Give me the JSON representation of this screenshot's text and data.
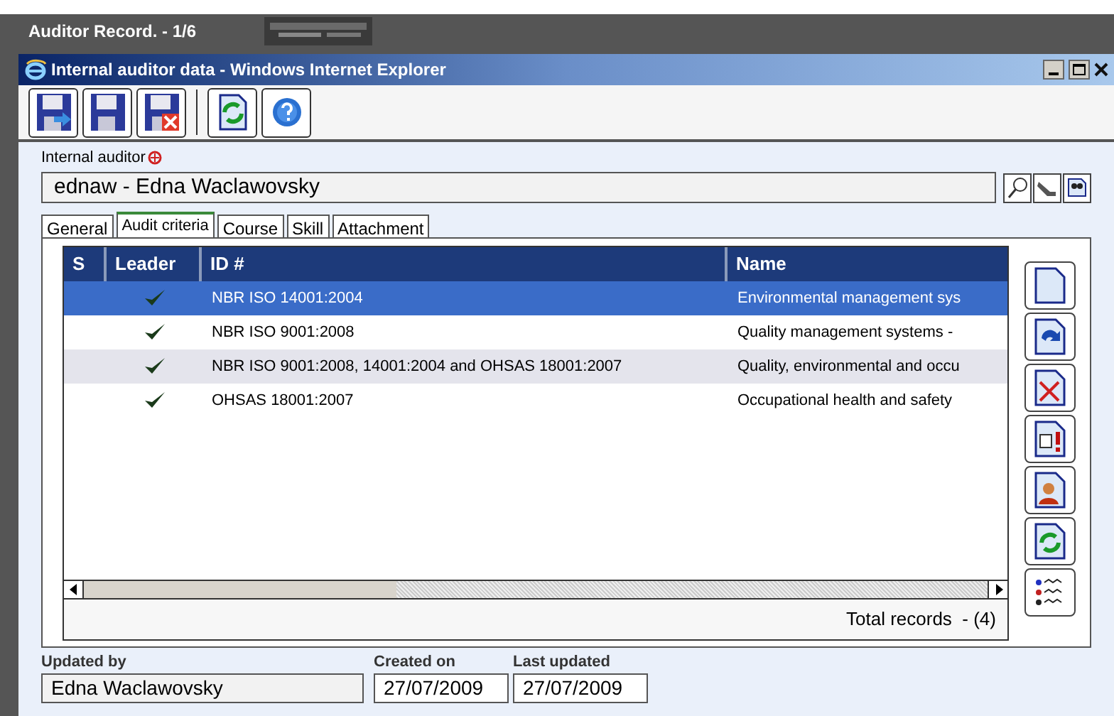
{
  "app_bar": {
    "title": "Auditor Record. - 1/6"
  },
  "window": {
    "title": "Internal auditor data - Windows Internet Explorer"
  },
  "auditor": {
    "label": "Internal auditor",
    "value": "ednaw - Edna Waclawovsky"
  },
  "tabs": [
    {
      "label": "General",
      "selected": false
    },
    {
      "label": "Audit criteria",
      "selected": true
    },
    {
      "label": "Course",
      "selected": false
    },
    {
      "label": "Skill",
      "selected": false
    },
    {
      "label": "Attachment",
      "selected": false
    }
  ],
  "table": {
    "columns": [
      "S",
      "Leader",
      "ID #",
      "Name"
    ],
    "rows": [
      {
        "id": "NBR ISO 14001:2004",
        "name": "Environmental management sys",
        "leader": true,
        "selected": true
      },
      {
        "id": "NBR ISO 9001:2008",
        "name": "Quality management systems -",
        "leader": true,
        "selected": false
      },
      {
        "id": "NBR ISO 9001:2008, 14001:2004 and OHSAS 18001:2007",
        "name": "Quality, environmental and occu",
        "leader": true,
        "selected": false
      },
      {
        "id": "OHSAS 18001:2007",
        "name": "Occupational health and safety",
        "leader": true,
        "selected": false
      }
    ],
    "total": "Total records  - (4)"
  },
  "footer": {
    "updated_by_label": "Updated by",
    "updated_by": "Edna Waclawovsky",
    "created_label": "Created on",
    "created": "27/07/2009",
    "last_label": "Last updated",
    "last": "27/07/2009"
  }
}
